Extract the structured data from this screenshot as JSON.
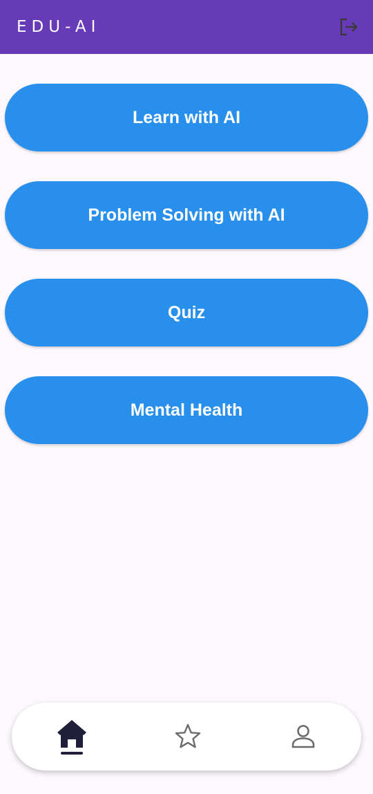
{
  "app_bar": {
    "title": "EDU-AI",
    "logout_icon": "logout-icon"
  },
  "menu": {
    "items": [
      {
        "label": "Learn with AI"
      },
      {
        "label": "Problem Solving with AI"
      },
      {
        "label": "Quiz"
      },
      {
        "label": "Mental Health"
      }
    ]
  },
  "bottom_nav": {
    "items": [
      {
        "icon": "home-icon",
        "active": true
      },
      {
        "icon": "star-icon",
        "active": false
      },
      {
        "icon": "user-icon",
        "active": false
      }
    ]
  },
  "colors": {
    "app_bar": "#673ab7",
    "button": "#2890ec",
    "background": "#fdf8fd",
    "nav_active": "#1f1f3a",
    "nav_inactive": "#6b6b6b"
  }
}
